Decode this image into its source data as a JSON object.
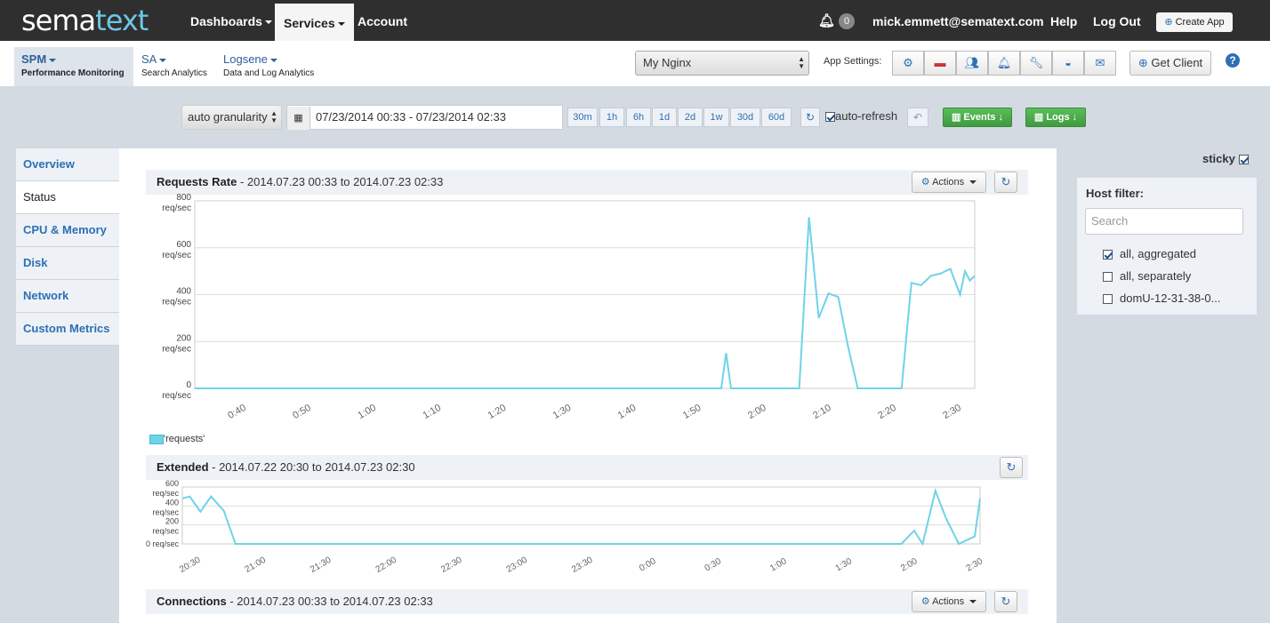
{
  "topbar": {
    "logo_text": "sema",
    "logo_accent": "text",
    "nav": [
      "Dashboards",
      "Services",
      "Account"
    ],
    "notifications_count": "0",
    "user_email": "mick.emmett@sematext.com",
    "help": "Help",
    "logout": "Log Out",
    "create_app": "Create App"
  },
  "subnav": {
    "tabs": [
      {
        "title": "SPM",
        "desc": "Performance Monitoring"
      },
      {
        "title": "SA",
        "desc": "Search Analytics"
      },
      {
        "title": "Logsene",
        "desc": "Data and Log Analytics"
      }
    ],
    "app_selected": "My Nginx",
    "app_settings_label": "App Settings:",
    "get_client": "Get Client"
  },
  "toolbar": {
    "granularity": "auto granularity",
    "date_range": "07/23/2014 00:33 - 07/23/2014 02:33",
    "ranges": [
      "30m",
      "1h",
      "6h",
      "1d",
      "2d",
      "1w",
      "30d",
      "60d"
    ],
    "auto_refresh": "auto-refresh",
    "events": "Events",
    "logs": "Logs"
  },
  "sidebar": [
    "Overview",
    "Status",
    "CPU & Memory",
    "Disk",
    "Network",
    "Custom Metrics"
  ],
  "panels": {
    "requests": {
      "title": "Requests Rate",
      "range": "- 2014.07.23 00:33 to 2014.07.23 02:33",
      "actions": "Actions"
    },
    "extended": {
      "title": "Extended",
      "range": "- 2014.07.22 20:30 to 2014.07.23 02:30"
    },
    "connections": {
      "title": "Connections",
      "range": "- 2014.07.23 00:33 to 2014.07.23 02:33",
      "actions": "Actions"
    }
  },
  "legend": "'requests'",
  "host_filter": {
    "sticky": "sticky",
    "title": "Host filter:",
    "search_placeholder": "Search",
    "options": [
      {
        "label": "all, aggregated",
        "checked": true
      },
      {
        "label": "all, separately",
        "checked": false
      },
      {
        "label": "domU-12-31-38-0...",
        "checked": false
      }
    ]
  },
  "chart_data": [
    {
      "type": "line",
      "title": "Requests Rate",
      "ylim": [
        0,
        800
      ],
      "y_ticks": [
        "800\nreq/sec",
        "600\nreq/sec",
        "400\nreq/sec",
        "200\nreq/sec",
        "0\nreq/sec"
      ],
      "x_ticks": [
        "0:40",
        "0:50",
        "1:00",
        "1:10",
        "1:20",
        "1:30",
        "1:40",
        "1:50",
        "2:00",
        "2:10",
        "2:20",
        "2:30"
      ],
      "series": [
        {
          "name": "'requests'",
          "color": "#6fd3e8",
          "x": [
            0,
            108,
            109,
            110,
            112,
            113,
            124,
            126,
            128,
            130,
            132,
            134,
            136,
            145,
            147,
            149,
            151,
            153,
            155,
            157,
            158,
            159,
            160
          ],
          "values": [
            0,
            0,
            150,
            0,
            0,
            0,
            0,
            730,
            300,
            405,
            390,
            180,
            0,
            0,
            450,
            440,
            480,
            490,
            510,
            400,
            500,
            460,
            480
          ]
        }
      ]
    },
    {
      "type": "line",
      "title": "Extended",
      "ylim": [
        0,
        600
      ],
      "y_ticks": [
        "600\nreq/sec",
        "400\nreq/sec",
        "200\nreq/sec",
        "0 req/sec"
      ],
      "x_ticks": [
        "20:30",
        "21:00",
        "21:30",
        "22:00",
        "22:30",
        "23:00",
        "23:30",
        "0:00",
        "0:30",
        "1:00",
        "1:30",
        "2:00",
        "2:30"
      ],
      "series": [
        {
          "name": "requests",
          "color": "#6fd3e8",
          "x": [
            0,
            7,
            17,
            27,
            39,
            50,
            60,
            600,
            676,
            688,
            696,
            708,
            718,
            730,
            745,
            750
          ],
          "values": [
            480,
            500,
            340,
            500,
            350,
            0,
            0,
            0,
            0,
            140,
            0,
            560,
            270,
            0,
            80,
            480
          ]
        }
      ]
    }
  ]
}
